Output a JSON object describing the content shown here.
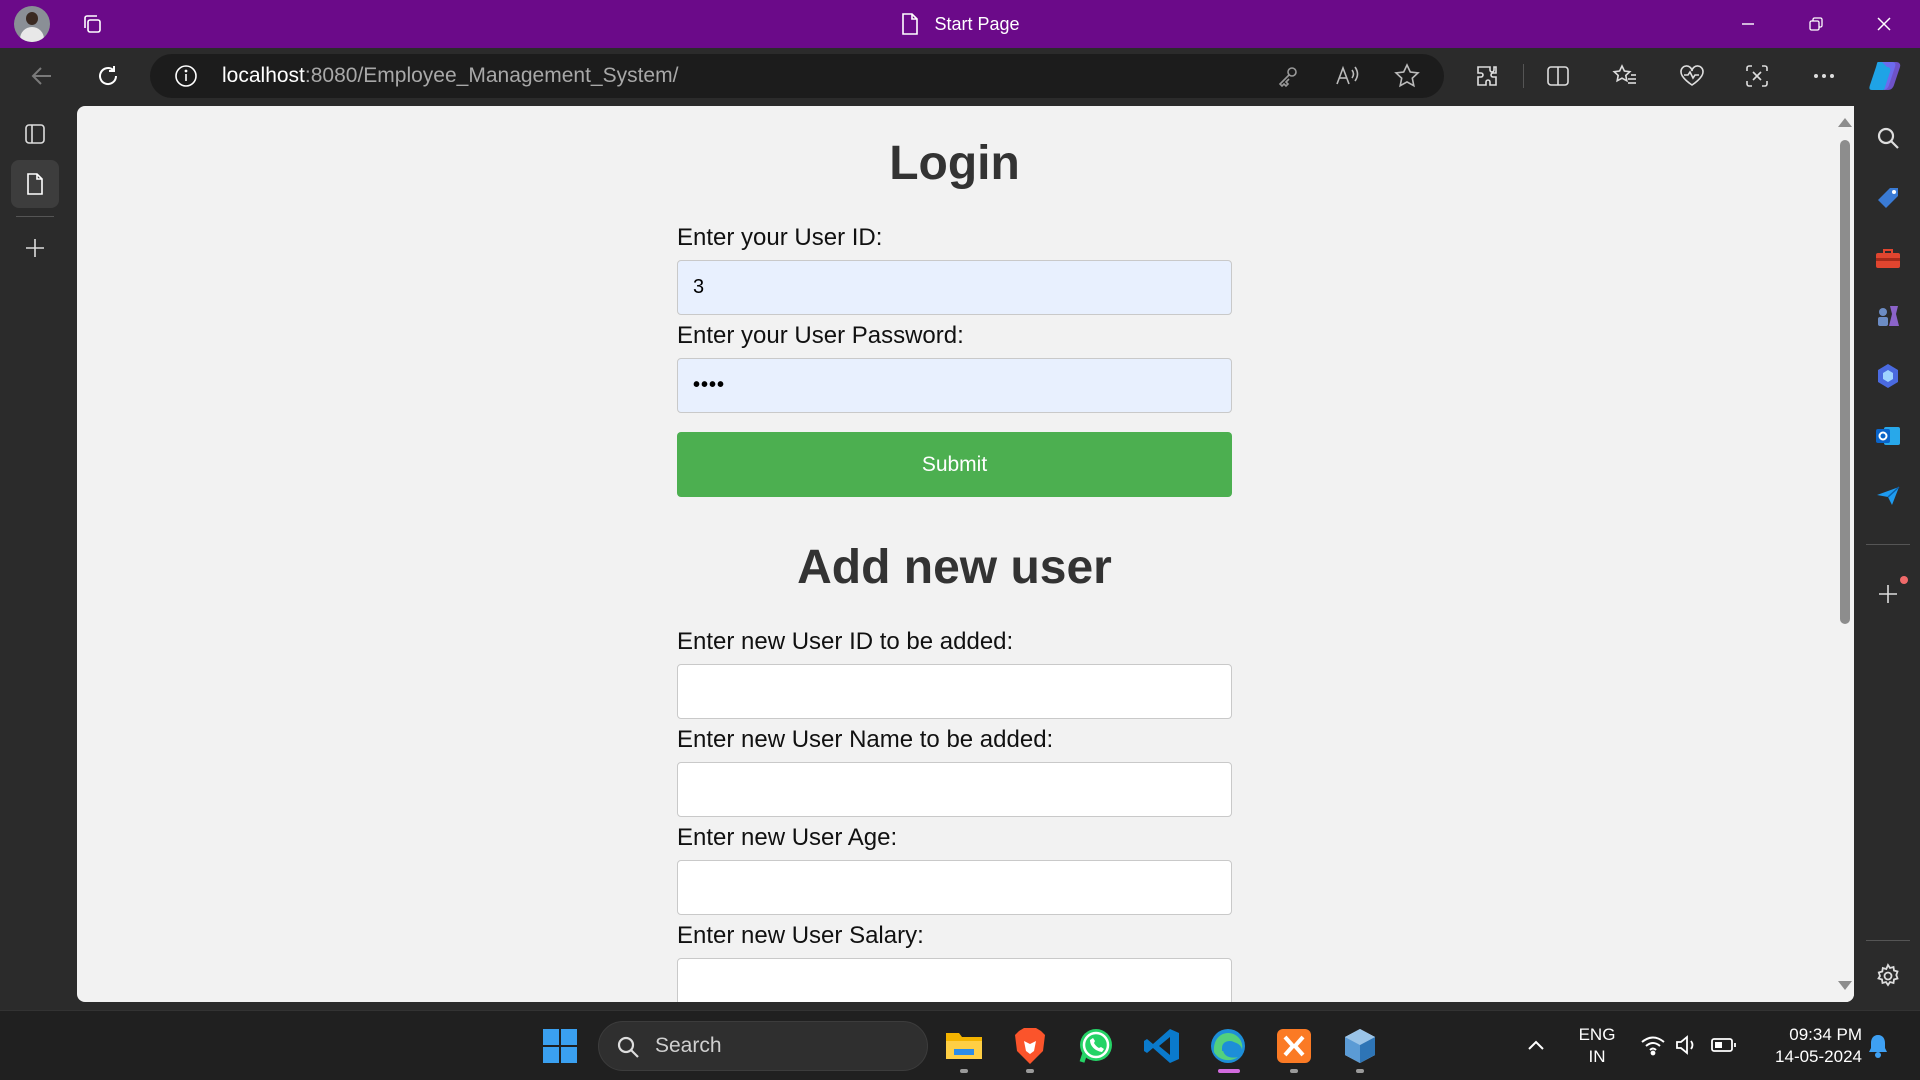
{
  "window": {
    "title": "Start Page"
  },
  "address_bar": {
    "host": "localhost",
    "rest": ":8080/Employee_Management_System/"
  },
  "page": {
    "login_heading": "Login",
    "user_id_label": "Enter your User ID:",
    "user_id_value": "3",
    "password_label": "Enter your User Password:",
    "password_mask": "••••",
    "submit_label": "Submit",
    "add_heading": "Add new user",
    "new_id_label": "Enter new User ID to be added:",
    "new_name_label": "Enter new User Name to be added:",
    "new_age_label": "Enter new User Age:",
    "new_salary_label": "Enter new User Salary:"
  },
  "taskbar": {
    "search_placeholder": "Search",
    "language_line1": "ENG",
    "language_line2": "IN",
    "time": "09:34 PM",
    "date": "14-05-2024"
  },
  "colors": {
    "titlebar": "#6b0a89",
    "submit_button": "#4caf50",
    "autofill_input": "#e8f0fe",
    "page_background": "#f2f2f2"
  },
  "icons": {
    "titlebar": [
      "profile-avatar",
      "workspaces-icon",
      "page-icon",
      "minimize-icon",
      "restore-icon",
      "close-icon"
    ],
    "toolbar": [
      "back-icon",
      "refresh-icon",
      "info-icon",
      "key-icon",
      "read-aloud-icon",
      "favorite-star-icon",
      "extensions-icon",
      "split-screen-icon",
      "favorites-icon",
      "browser-essentials-icon",
      "screenshot-icon",
      "more-icon",
      "copilot-icon"
    ],
    "sidebar": [
      "search-icon",
      "shopping-icon",
      "tools-icon",
      "games-icon",
      "copilot-sidebar-icon",
      "outlook-icon",
      "drop-icon",
      "add-icon",
      "settings-icon"
    ],
    "taskbar": [
      "windows-start-icon",
      "file-explorer-icon",
      "brave-icon",
      "whatsapp-icon",
      "vscode-icon",
      "edge-icon",
      "xampp-icon",
      "netbeans-icon"
    ]
  }
}
